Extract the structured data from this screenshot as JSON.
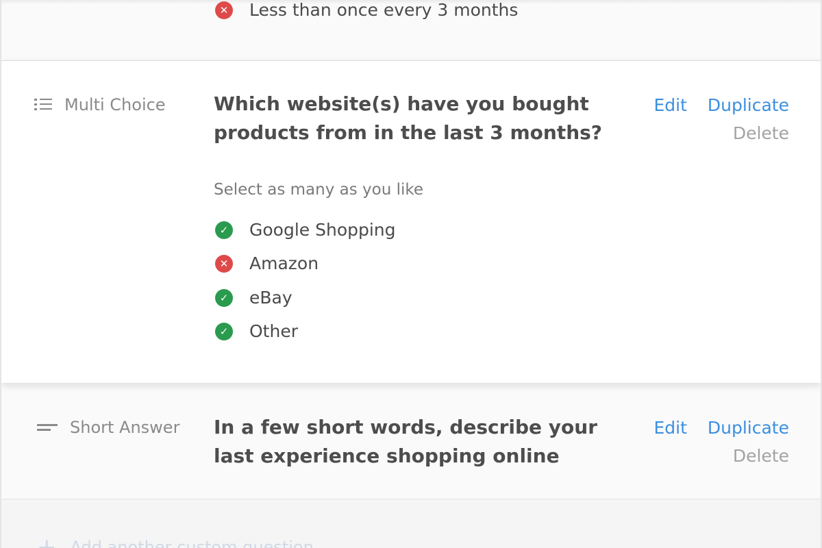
{
  "previous_question": {
    "option": {
      "state": "incorrect",
      "text": "Less than once every 3 months"
    }
  },
  "active_question": {
    "type_label": "Multi Choice",
    "type_icon": "list-icon",
    "title": "Which website(s) have you bought products from in the last 3 months?",
    "edit_label": "Edit",
    "duplicate_label": "Duplicate",
    "delete_label": "Delete",
    "hint": "Select as many as you like",
    "options": [
      {
        "state": "correct",
        "text": "Google Shopping"
      },
      {
        "state": "incorrect",
        "text": "Amazon"
      },
      {
        "state": "correct",
        "text": "eBay"
      },
      {
        "state": "correct",
        "text": "Other"
      }
    ]
  },
  "next_question": {
    "type_label": "Short Answer",
    "type_icon": "short-answer-icon",
    "title": "In a few short words, describe your last experience shopping online",
    "edit_label": "Edit",
    "duplicate_label": "Duplicate",
    "delete_label": "Delete"
  },
  "footer": {
    "add_question_label": "Add another custom question"
  },
  "colors": {
    "accent": "#3b8fe0",
    "correct": "#2a9a4e",
    "incorrect": "#de4a4a",
    "muted": "#a3a3a3"
  }
}
